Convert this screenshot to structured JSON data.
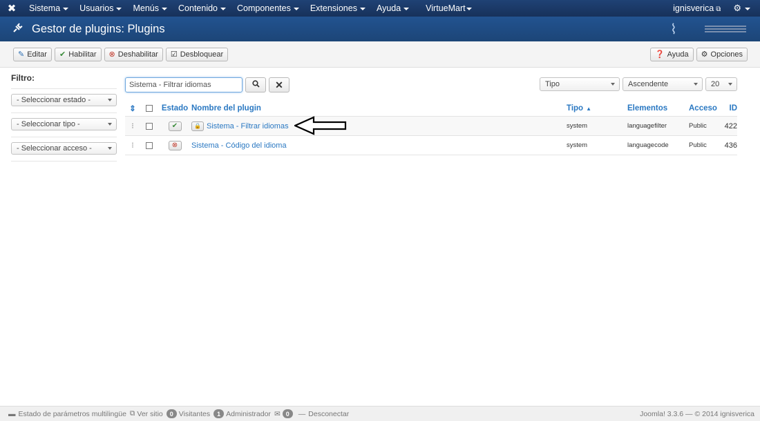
{
  "navbar": {
    "logo_icon": "joomla-logo-icon",
    "menus": [
      "Sistema",
      "Usuarios",
      "Menús",
      "Contenido",
      "Componentes",
      "Extensiones",
      "Ayuda",
      "VirtueMart"
    ],
    "user": "ignisverica",
    "settings_icon": "gear-icon"
  },
  "header": {
    "icon": "plug-icon",
    "title": "Gestor de plugins: Plugins"
  },
  "toolbar": {
    "edit": "Editar",
    "enable": "Habilitar",
    "disable": "Deshabilitar",
    "checkin": "Desbloquear",
    "help": "Ayuda",
    "options": "Opciones"
  },
  "sidebar": {
    "title": "Filtro:",
    "state_placeholder": "- Seleccionar estado -",
    "type_placeholder": "- Seleccionar tipo -",
    "access_placeholder": "- Seleccionar acceso -"
  },
  "search": {
    "value": "Sistema - Filtrar idiomas"
  },
  "list_controls": {
    "sort_field": "Tipo",
    "sort_direction": "Ascendente",
    "limit": "20"
  },
  "table": {
    "headers": {
      "state": "Estado",
      "name": "Nombre del plugin",
      "type": "Tipo",
      "elements": "Elementos",
      "access": "Acceso",
      "id": "ID"
    },
    "rows": [
      {
        "enabled": true,
        "locked": true,
        "name": "Sistema - Filtrar idiomas",
        "type": "system",
        "element": "languagefilter",
        "access": "Public",
        "id": "422"
      },
      {
        "enabled": false,
        "locked": false,
        "name": "Sistema - Código del idioma",
        "type": "system",
        "element": "languagecode",
        "access": "Public",
        "id": "436"
      }
    ]
  },
  "footer": {
    "multilang": "Estado de parámetros multilingüe",
    "view_site": "Ver sitio",
    "visitors_count": "0",
    "visitors": "Visitantes",
    "admins_count": "1",
    "admins": "Administrador",
    "messages_count": "0",
    "logout": "Desconectar",
    "version": "Joomla! 3.3.6 — © 2014 ignisverica"
  }
}
